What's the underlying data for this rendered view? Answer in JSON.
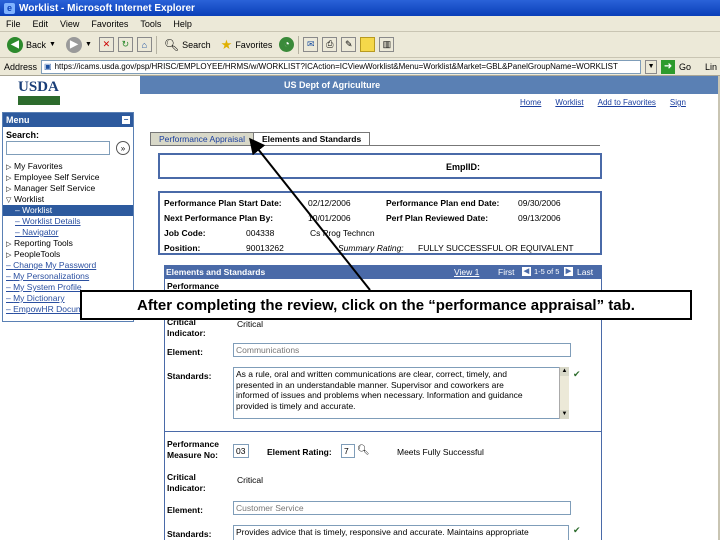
{
  "window": {
    "title": "Worklist - Microsoft Internet Explorer"
  },
  "menubar": [
    "File",
    "Edit",
    "View",
    "Favorites",
    "Tools",
    "Help"
  ],
  "toolbar": {
    "back_label": "Back",
    "search_label": "Search",
    "favorites_label": "Favorites"
  },
  "address": {
    "label": "Address",
    "url": "https://icams.usda.gov/psp/HRISC/EMPLOYEE/HRMS/w/WORKLIST?ICAction=ICViewWorklist&Menu=Worklist&Market=GBL&PanelGroupName=WORKLIST",
    "go_label": "Go",
    "links_label": "Lin"
  },
  "header": {
    "logo_text": "USDA",
    "banner": "US Dept of Agriculture",
    "links": [
      "Home",
      "Worklist",
      "Add to Favorites",
      "Sign"
    ]
  },
  "leftmenu": {
    "title": "Menu",
    "search_label": "Search:",
    "items": [
      {
        "label": "My Favorites",
        "kind": "folder"
      },
      {
        "label": "Employee Self Service",
        "kind": "folder"
      },
      {
        "label": "Manager Self Service",
        "kind": "folder"
      },
      {
        "label": "Worklist",
        "kind": "folder-open"
      },
      {
        "label": "Worklist",
        "kind": "selected"
      },
      {
        "label": "Worklist Details",
        "kind": "sublink"
      },
      {
        "label": "Navigator",
        "kind": "sublink"
      },
      {
        "label": "Reporting Tools",
        "kind": "folder"
      },
      {
        "label": "PeopleTools",
        "kind": "folder"
      },
      {
        "label": "Change My Password",
        "kind": "link"
      },
      {
        "label": "My Personalizations",
        "kind": "link"
      },
      {
        "label": "My System Profile",
        "kind": "link"
      },
      {
        "label": "My Dictionary",
        "kind": "link"
      },
      {
        "label": "EmpowHR Documentation",
        "kind": "link"
      }
    ]
  },
  "tabs": [
    {
      "label": "Performance Appraisal",
      "active": false
    },
    {
      "label": "Elements and Standards",
      "active": true
    }
  ],
  "empl": {
    "label": "EmplID:"
  },
  "plan": {
    "start_label": "Performance Plan Start Date:",
    "start_value": "02/12/2006",
    "end_label": "Performance Plan end Date:",
    "end_value": "09/30/2006",
    "next_label": "Next Performance Plan By:",
    "next_value": "10/01/2006",
    "reviewed_label": "Perf Plan Reviewed Date:",
    "reviewed_value": "09/13/2006",
    "job_label": "Job Code:",
    "job_value": "004338",
    "job_title": "Cs Prog Techncn",
    "position_label": "Position:",
    "position_value": "90013262",
    "summary_label": "Summary Rating:",
    "summary_value": "FULLY SUCCESSFUL OR EQUIVALENT"
  },
  "elements": {
    "title": "Elements and Standards",
    "view_all": "View 1",
    "first": "First",
    "range": "1-5 of 5",
    "last": "Last",
    "blocks": [
      {
        "perf_label": "Performance",
        "critical_label": "Critical Indicator:",
        "critical_value": "Critical",
        "element_label": "Element:",
        "element_value": "Communications",
        "standards_label": "Standards:",
        "standards_lines": [
          "As a rule, oral and written communications are clear, correct, timely, and",
          "presented in an understandable manner. Supervisor and coworkers are",
          "informed of issues and problems when necessary. Information and guidance",
          "provided is timely and accurate."
        ]
      },
      {
        "perf_label": "Performance Measure No:",
        "perf_value": "03",
        "rating_label": "Element Rating:",
        "rating_value": "7",
        "rating_desc": "Meets Fully Successful",
        "critical_label": "Critical Indicator:",
        "critical_value": "Critical",
        "element_label": "Element:",
        "element_value": "Customer Service",
        "standards_label": "Standards:",
        "standards_lines": [
          "Provides advice that is timely, responsive and accurate. Maintains appropriate"
        ]
      }
    ]
  },
  "callout": {
    "text": "After completing the review, click on the “performance appraisal” tab."
  }
}
